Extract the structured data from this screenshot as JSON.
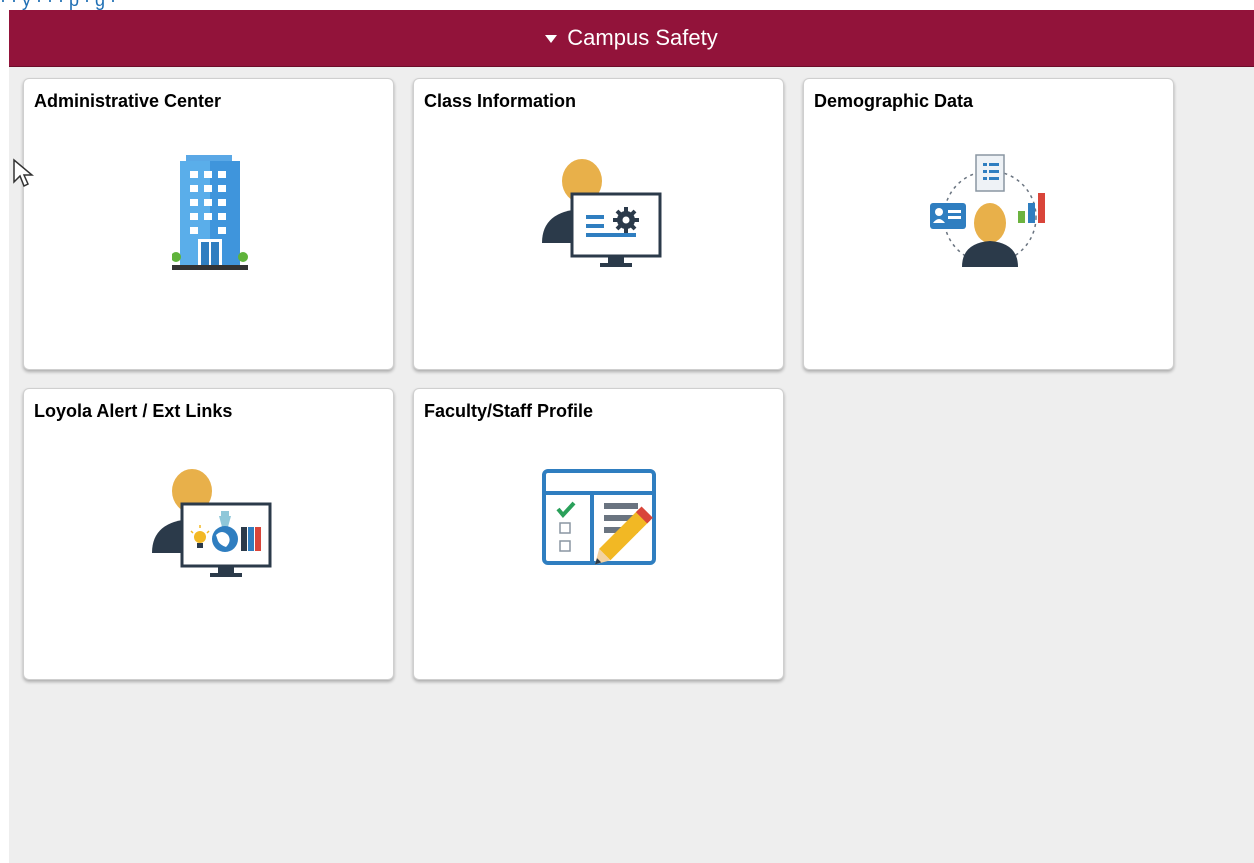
{
  "top_link": {
    "text": "· · y · · · p · g ·"
  },
  "banner": {
    "label": "Campus Safety",
    "color": "#92133a"
  },
  "tiles": [
    {
      "title": "Administrative Center",
      "icon": "office-building-icon"
    },
    {
      "title": "Class Information",
      "icon": "person-monitor-gear-icon"
    },
    {
      "title": "Demographic Data",
      "icon": "demographic-data-icon"
    },
    {
      "title": "Loyola Alert / Ext Links",
      "icon": "person-monitor-globe-icon"
    },
    {
      "title": "Faculty/Staff Profile",
      "icon": "checklist-pencil-icon"
    }
  ],
  "colors": {
    "background": "#eeeeee",
    "tile": "#ffffff",
    "person": "#e8b04a",
    "dark": "#2b3a4a",
    "blue": "#2f7ec0"
  }
}
